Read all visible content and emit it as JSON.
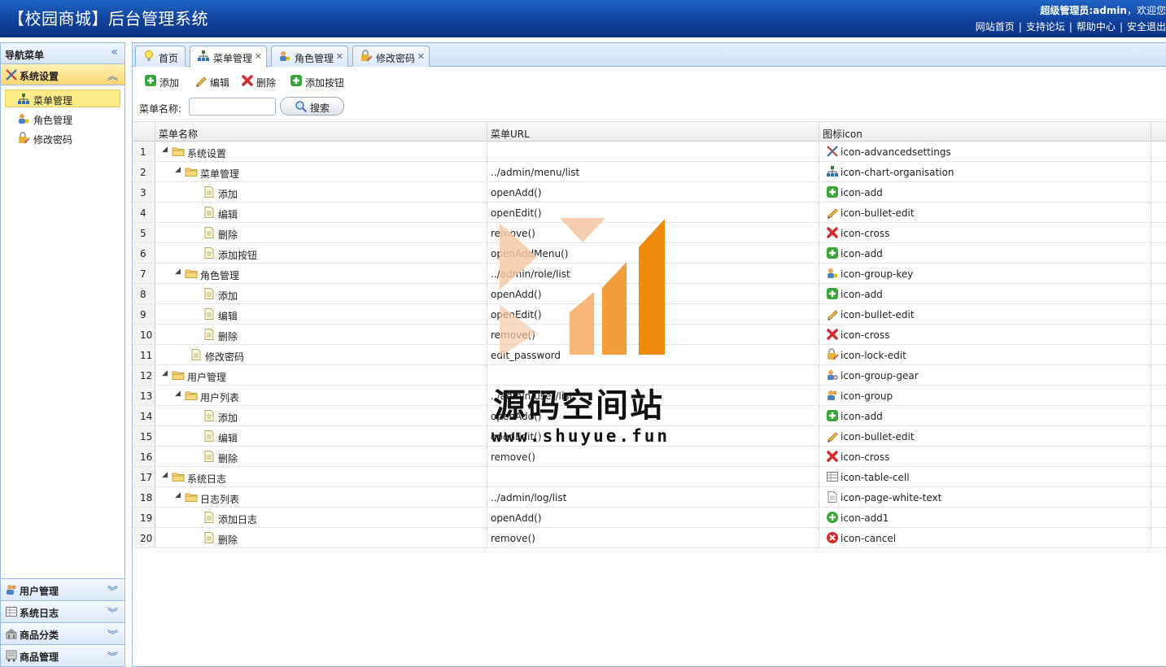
{
  "header": {
    "title": "【校园商城】后台管理系统",
    "welcome_prefix": "超级管理员:admin",
    "welcome_suffix": "，欢迎您",
    "links": [
      "网站首页",
      "支持论坛",
      "帮助中心",
      "安全退出"
    ]
  },
  "sidebar": {
    "title": "导航菜单",
    "open_group": "系统设置",
    "items": [
      "菜单管理",
      "角色管理",
      "修改密码"
    ],
    "collapsed_groups": [
      "用户管理",
      "系统日志",
      "商品分类",
      "商品管理"
    ]
  },
  "tabs": [
    {
      "label": "首页",
      "closable": false
    },
    {
      "label": "菜单管理",
      "closable": true,
      "active": true
    },
    {
      "label": "角色管理",
      "closable": true
    },
    {
      "label": "修改密码",
      "closable": true
    }
  ],
  "toolbar": {
    "add": "添加",
    "edit": "编辑",
    "delete": "删除",
    "add_button": "添加按钮"
  },
  "search": {
    "label": "菜单名称:",
    "value": "",
    "button": "搜索"
  },
  "grid": {
    "columns": [
      "菜单名称",
      "菜单URL",
      "图标icon"
    ],
    "rows": [
      {
        "n": "1",
        "name": "系统设置",
        "url": "",
        "icon": "icon-advancedsettings"
      },
      {
        "n": "2",
        "name": "菜单管理",
        "url": "../admin/menu/list",
        "icon": "icon-chart-organisation"
      },
      {
        "n": "3",
        "name": "添加",
        "url": "openAdd()",
        "icon": "icon-add"
      },
      {
        "n": "4",
        "name": "编辑",
        "url": "openEdit()",
        "icon": "icon-bullet-edit"
      },
      {
        "n": "5",
        "name": "删除",
        "url": "remove()",
        "icon": "icon-cross"
      },
      {
        "n": "6",
        "name": "添加按钮",
        "url": "openAddMenu()",
        "icon": "icon-add"
      },
      {
        "n": "7",
        "name": "角色管理",
        "url": "../admin/role/list",
        "icon": "icon-group-key"
      },
      {
        "n": "8",
        "name": "添加",
        "url": "openAdd()",
        "icon": "icon-add"
      },
      {
        "n": "9",
        "name": "编辑",
        "url": "openEdit()",
        "icon": "icon-bullet-edit"
      },
      {
        "n": "10",
        "name": "删除",
        "url": "remove()",
        "icon": "icon-cross"
      },
      {
        "n": "11",
        "name": "修改密码",
        "url": "edit_password",
        "icon": "icon-lock-edit"
      },
      {
        "n": "12",
        "name": "用户管理",
        "url": "",
        "icon": "icon-group-gear"
      },
      {
        "n": "13",
        "name": "用户列表",
        "url": "../admin/user/list",
        "icon": "icon-group"
      },
      {
        "n": "14",
        "name": "添加",
        "url": "openAdd()",
        "icon": "icon-add"
      },
      {
        "n": "15",
        "name": "编辑",
        "url": "openEdit()",
        "icon": "icon-bullet-edit"
      },
      {
        "n": "16",
        "name": "删除",
        "url": "remove()",
        "icon": "icon-cross"
      },
      {
        "n": "17",
        "name": "系统日志",
        "url": "",
        "icon": "icon-table-cell"
      },
      {
        "n": "18",
        "name": "日志列表",
        "url": "../admin/log/list",
        "icon": "icon-page-white-text"
      },
      {
        "n": "19",
        "name": "添加日志",
        "url": "openAdd()",
        "icon": "icon-add1"
      },
      {
        "n": "20",
        "name": "删除",
        "url": "remove()",
        "icon": "icon-cancel"
      }
    ]
  },
  "watermark": {
    "text": "源码空间站",
    "url": "www.shuyue.fun"
  },
  "colors": {
    "header_blue": "#0f3f9a",
    "selected_yellow": "#fbec88",
    "border_blue": "#99bbe8",
    "watermark_orange": "#f08a0c"
  }
}
